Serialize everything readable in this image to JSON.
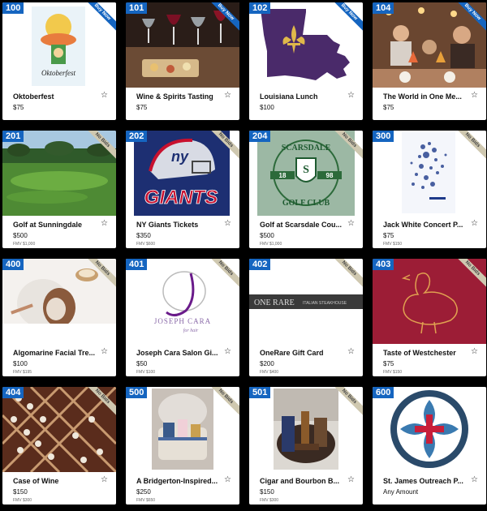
{
  "items": [
    {
      "lot": "100",
      "title": "Oktoberfest",
      "price": "$75",
      "fmv": "",
      "ribbon": "Buy Now",
      "icon": "star-icon",
      "poster_text": "Oktoberfest"
    },
    {
      "lot": "101",
      "title": "Wine & Spirits Tasting",
      "price": "$75",
      "fmv": "",
      "ribbon": "Buy Now",
      "icon": "star-icon"
    },
    {
      "lot": "102",
      "title": "Louisiana Lunch",
      "price": "$100",
      "fmv": "",
      "ribbon": "Buy Now",
      "icon": "star-icon"
    },
    {
      "lot": "104",
      "title": "The World in One Me...",
      "price": "$75",
      "fmv": "",
      "ribbon": "Buy Now",
      "icon": "star-icon"
    },
    {
      "lot": "201",
      "title": "Golf at Sunningdale",
      "price": "$500",
      "fmv": "FMV $1,000",
      "ribbon": "No Bids",
      "icon": "star-icon"
    },
    {
      "lot": "202",
      "title": "NY Giants Tickets",
      "price": "$350",
      "fmv": "FMV $600",
      "ribbon": "No Bids",
      "icon": "star-icon",
      "logo_text": "GIANTS",
      "ny_text": "ny"
    },
    {
      "lot": "204",
      "title": "Golf at Scarsdale Cou...",
      "price": "$500",
      "fmv": "FMV $1,000",
      "ribbon": "No Bids",
      "icon": "star-icon",
      "club_top": "SCARSDALE",
      "club_bottom": "GOLF CLUB",
      "year_left": "18",
      "year_right": "98"
    },
    {
      "lot": "300",
      "title": "Jack White Concert P...",
      "price": "$75",
      "fmv": "FMV $150",
      "ribbon": "No Bids",
      "icon": "star-icon"
    },
    {
      "lot": "400",
      "title": "Algomarine Facial Tre...",
      "price": "$100",
      "fmv": "FMV $195",
      "ribbon": "No Bids",
      "icon": "star-icon"
    },
    {
      "lot": "401",
      "title": "Joseph Cara Salon Gi...",
      "price": "$50",
      "fmv": "FMV $100",
      "ribbon": "No Bids",
      "icon": "star-icon",
      "brand": "JOSEPH CARA",
      "brand_sub": "for hair"
    },
    {
      "lot": "402",
      "title": "OneRare Gift Card",
      "price": "$200",
      "fmv": "FMV $400",
      "ribbon": "No Bids",
      "icon": "star-icon",
      "brand": "ONE RARE",
      "brand_sub": "ITALIAN STEAKHOUSE"
    },
    {
      "lot": "403",
      "title": "Taste of Westchester",
      "price": "$75",
      "fmv": "FMV $150",
      "ribbon": "No Bids",
      "icon": "star-icon"
    },
    {
      "lot": "404",
      "title": "Case of Wine",
      "price": "$150",
      "fmv": "FMV $300",
      "ribbon": "No Bids",
      "icon": "star-icon"
    },
    {
      "lot": "500",
      "title": "A Bridgerton-Inspired...",
      "price": "$250",
      "fmv": "FMV $650",
      "ribbon": "No Bids",
      "icon": "star-icon"
    },
    {
      "lot": "501",
      "title": "Cigar and Bourbon B...",
      "price": "$150",
      "fmv": "FMV $300",
      "ribbon": "No Bids",
      "icon": "star-icon"
    },
    {
      "lot": "600",
      "title": "St. James Outreach P...",
      "price": "Any Amount",
      "fmv": "",
      "ribbon": "",
      "icon": "star-icon"
    }
  ],
  "colors": {
    "lot_badge": "#1565c0",
    "buy_now_ribbon": "#1565c0",
    "no_bids_ribbon": "#cfc8b0"
  }
}
